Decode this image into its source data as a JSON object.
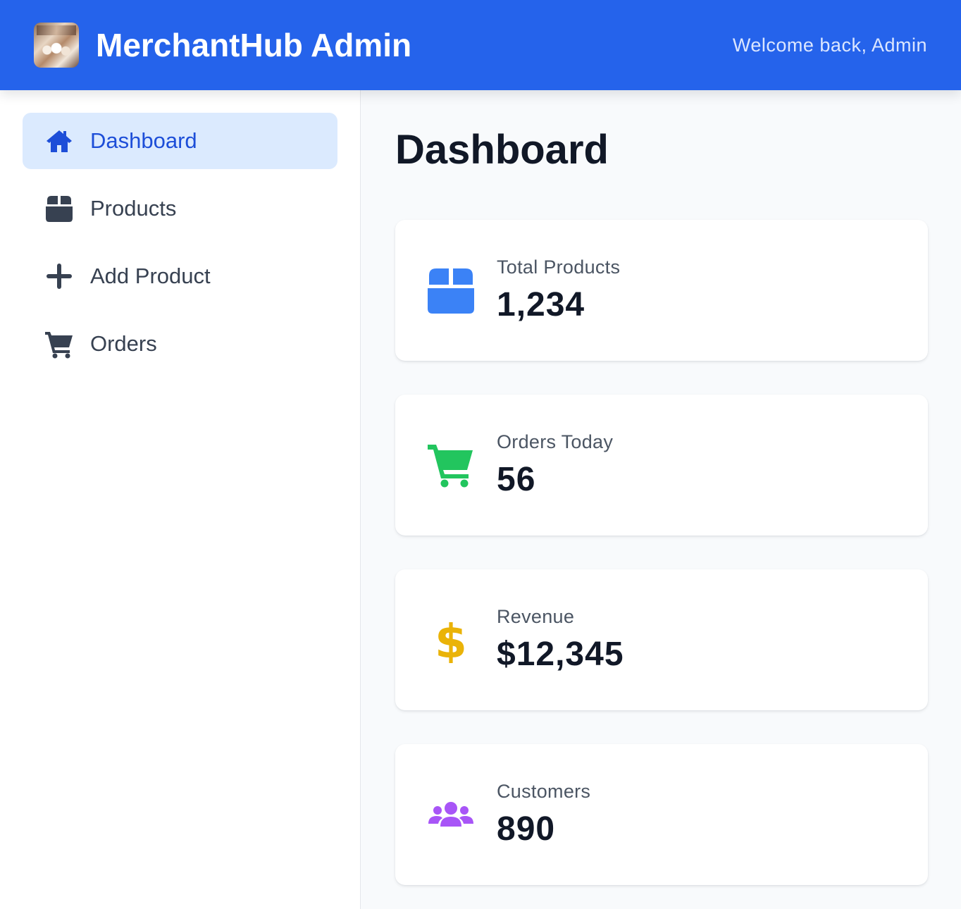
{
  "header": {
    "title": "MerchantHub Admin",
    "welcome": "Welcome back, Admin",
    "background": "#2563eb"
  },
  "sidebar": {
    "items": [
      {
        "label": "Dashboard",
        "icon": "home-icon",
        "active": true
      },
      {
        "label": "Products",
        "icon": "box-icon",
        "active": false
      },
      {
        "label": "Add Product",
        "icon": "plus-icon",
        "active": false
      },
      {
        "label": "Orders",
        "icon": "cart-icon",
        "active": false
      }
    ]
  },
  "main": {
    "title": "Dashboard",
    "cards": [
      {
        "label": "Total Products",
        "value": "1,234",
        "icon": "box-icon",
        "color": "#3b82f6"
      },
      {
        "label": "Orders Today",
        "value": "56",
        "icon": "cart-icon",
        "color": "#22c55e"
      },
      {
        "label": "Revenue",
        "value": "$12,345",
        "icon": "dollar-icon",
        "color": "#eab308"
      },
      {
        "label": "Customers",
        "value": "890",
        "icon": "users-icon",
        "color": "#a855f7"
      }
    ]
  }
}
